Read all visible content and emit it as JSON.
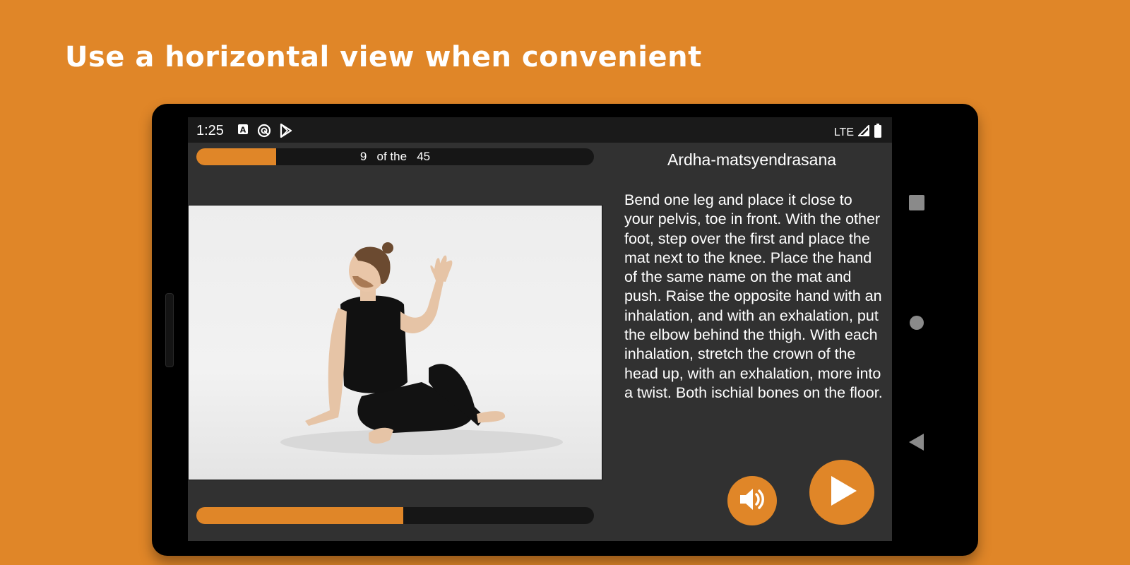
{
  "headline": "Use a horizontal view when convenient",
  "status_bar": {
    "time": "1:25",
    "left_icons": [
      "font-icon",
      "sync-icon",
      "play-store-icon"
    ],
    "network": "LTE"
  },
  "top_progress": {
    "current": "9",
    "separator": "of the",
    "total": "45",
    "fraction": 0.2
  },
  "pose": {
    "title": "Ardha-matsyendrasana",
    "description": "Bend one leg and place it close to your pelvis, toe in front. With the other foot, step over the first and place the mat next to the knee. Place the hand of the same name on the mat and push. Raise the opposite hand with an inhalation, and with an exhalation, put the elbow behind the thigh. With each inhalation, stretch the crown of the head up, with an exhalation, more into a twist. Both ischial bones on the floor."
  },
  "bottom_progress": {
    "fraction": 0.52
  },
  "controls": {
    "sound_icon": "volume-icon",
    "play_icon": "play-icon"
  },
  "colors": {
    "accent": "#E08628",
    "screen_bg": "#313131",
    "track": "#161616"
  }
}
